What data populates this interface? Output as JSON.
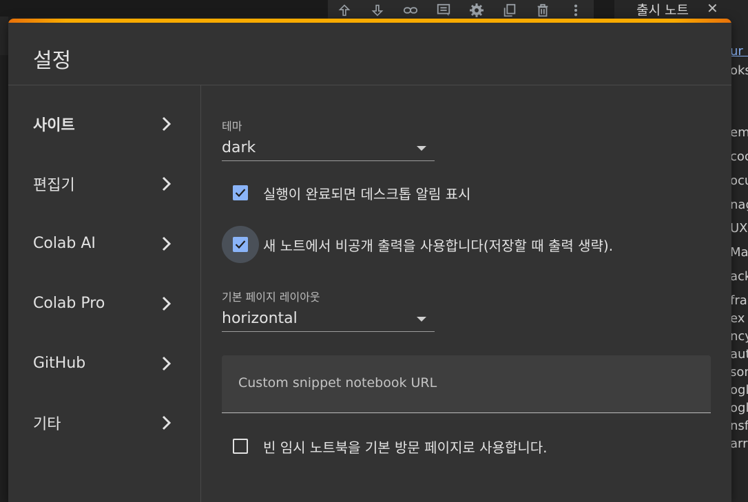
{
  "background": {
    "toolbar_icons": [
      "arrow-up-icon",
      "arrow-down-icon",
      "link-icon",
      "comment-icon",
      "gear-icon",
      "mirror-cell-icon",
      "delete-icon",
      "more-vert-icon"
    ],
    "right_panel": {
      "tab_title": "출시 노트",
      "fragments": [
        "ur b",
        "oks",
        "em",
        "coc",
        "ocu",
        "nag",
        "UX",
        "Ma",
        "ack",
        "fra",
        "ex",
        "ncy",
        "auth",
        "son",
        "ogl",
        "ogl",
        "nsf",
        "arro"
      ]
    }
  },
  "dialog": {
    "title": "설정",
    "accent_colors": [
      "#e8710a",
      "#f9ab00"
    ],
    "nav": [
      {
        "label": "사이트",
        "active": true
      },
      {
        "label": "편집기",
        "active": false
      },
      {
        "label": "Colab AI",
        "active": false
      },
      {
        "label": "Colab Pro",
        "active": false
      },
      {
        "label": "GitHub",
        "active": false
      },
      {
        "label": "기타",
        "active": false
      }
    ],
    "theme": {
      "label": "테마",
      "value": "dark"
    },
    "notify": {
      "label": "실행이 완료되면 데스크톱 알림 표시",
      "checked": true
    },
    "private_output": {
      "label": "새 노트에서 비공개 출력을 사용합니다(저장할 때 출력 생략).",
      "checked": true
    },
    "layout": {
      "label": "기본 페이지 레이아웃",
      "value": "horizontal"
    },
    "snippet_url": {
      "placeholder": "Custom snippet notebook URL",
      "value": ""
    },
    "blank_notebook": {
      "label": "빈 임시 노트북을 기본 방문 페이지로 사용합니다.",
      "checked": false
    },
    "checkbox_color": "#8ab4f8"
  }
}
